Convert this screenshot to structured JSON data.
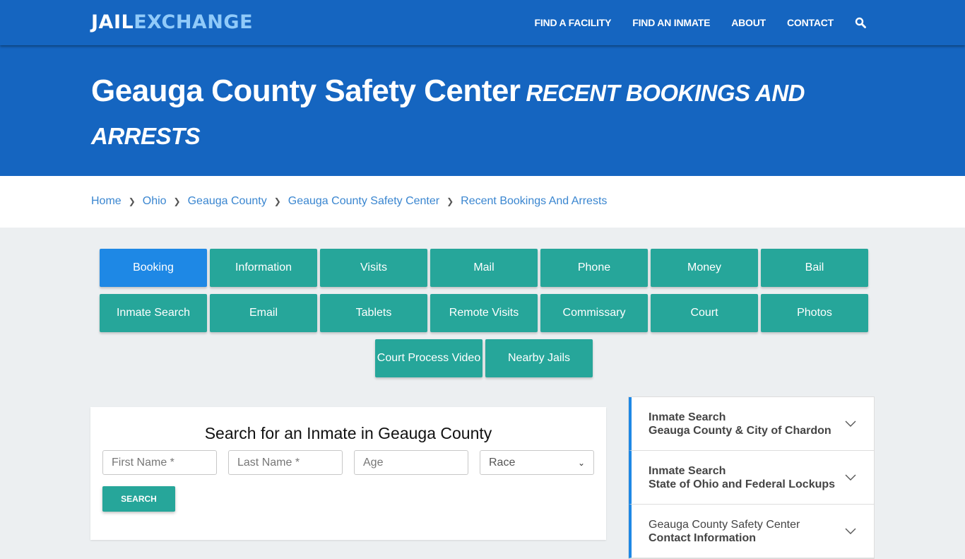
{
  "header": {
    "logo_part1": "JAIL",
    "logo_part2": "EXCHANGE",
    "nav": [
      "FIND A FACILITY",
      "FIND AN INMATE",
      "ABOUT",
      "CONTACT"
    ],
    "search_icon": "search-icon"
  },
  "hero": {
    "title": "Geauga County Safety Center",
    "subtitle": "RECENT BOOKINGS AND ARRESTS"
  },
  "breadcrumb": [
    "Home",
    "Ohio",
    "Geauga County",
    "Geauga County Safety Center",
    "Recent Bookings And Arrests"
  ],
  "tabs": {
    "row1": [
      "Booking",
      "Information",
      "Visits",
      "Mail",
      "Phone",
      "Money",
      "Bail"
    ],
    "row2": [
      "Inmate Search",
      "Email",
      "Tablets",
      "Remote Visits",
      "Commissary",
      "Court",
      "Photos"
    ],
    "row3": [
      "Court Process Video",
      "Nearby Jails"
    ],
    "active": "Booking"
  },
  "search": {
    "title": "Search for an Inmate in Geauga County",
    "first_name_placeholder": "First Name *",
    "last_name_placeholder": "Last Name *",
    "age_placeholder": "Age",
    "race_selected": "Race",
    "button": "SEARCH"
  },
  "sidebar": {
    "items": [
      {
        "line1": "Inmate Search",
        "line2": "Geauga County & City of Chardon"
      },
      {
        "line1": "Inmate Search",
        "line2": "State of Ohio and Federal Lockups"
      },
      {
        "line1": "Geauga County Safety Center",
        "line2": "Contact Information"
      }
    ]
  },
  "colors": {
    "brand_blue": "#1565c0",
    "logo_accent": "#90caf9",
    "active_tab": "#1e88e5",
    "teal": "#26a69a",
    "link": "#3a86d0"
  }
}
